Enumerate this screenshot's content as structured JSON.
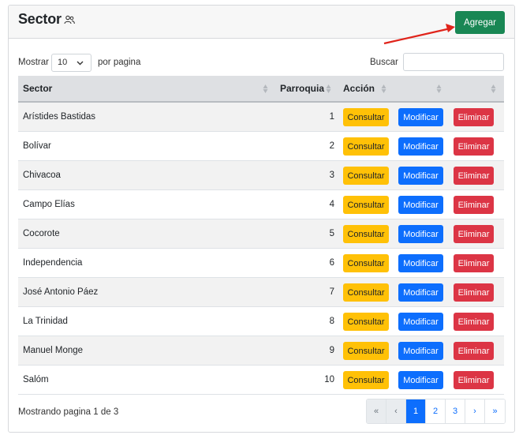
{
  "header": {
    "title": "Sector",
    "title_icon": "users-icon",
    "add_label": "Agregar"
  },
  "controls": {
    "show_label": "Mostrar",
    "page_size": "10",
    "per_page_label": "por pagina",
    "search_label": "Buscar",
    "search_value": ""
  },
  "table": {
    "columns": [
      "Sector",
      "Parroquia",
      "Acción"
    ],
    "rows": [
      {
        "sector": "Arístides Bastidas",
        "parroquia": "1"
      },
      {
        "sector": "Bolívar",
        "parroquia": "2"
      },
      {
        "sector": "Chivacoa",
        "parroquia": "3"
      },
      {
        "sector": "Campo Elías",
        "parroquia": "4"
      },
      {
        "sector": "Cocorote",
        "parroquia": "5"
      },
      {
        "sector": "Independencia",
        "parroquia": "6"
      },
      {
        "sector": "José Antonio Páez",
        "parroquia": "7"
      },
      {
        "sector": "La Trinidad",
        "parroquia": "8"
      },
      {
        "sector": "Manuel Monge",
        "parroquia": "9"
      },
      {
        "sector": "Salóm",
        "parroquia": "10"
      }
    ],
    "actions": {
      "consultar": "Consultar",
      "modificar": "Modificar",
      "eliminar": "Eliminar"
    }
  },
  "footer": {
    "info": "Mostrando pagina 1 de 3",
    "pages": [
      "«",
      "‹",
      "1",
      "2",
      "3",
      "›",
      "»"
    ],
    "active_page": "1"
  },
  "colors": {
    "add": "#198754",
    "consultar": "#ffc107",
    "modificar": "#0d6efd",
    "eliminar": "#dc3545",
    "arrow": "#e0241b"
  }
}
